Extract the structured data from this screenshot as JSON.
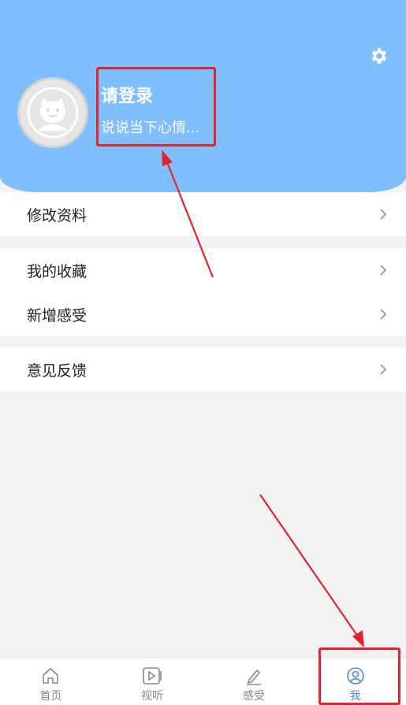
{
  "profile": {
    "login_text": "请登录",
    "mood_text": "说说当下心情...",
    "avatar_icon": "avatar-placeholder-icon",
    "settings_icon": "gear-icon"
  },
  "menu": {
    "edit_profile": "修改资料",
    "my_favorites": "我的收藏",
    "add_feeling": "新增感受",
    "feedback": "意见反馈"
  },
  "tabbar": {
    "items": [
      {
        "label": "首页",
        "icon": "home-icon"
      },
      {
        "label": "视听",
        "icon": "video-icon"
      },
      {
        "label": "感受",
        "icon": "pen-icon"
      },
      {
        "label": "我",
        "icon": "user-icon"
      }
    ],
    "active_index": 3
  },
  "colors": {
    "header_bg": "#80bfff",
    "page_bg": "#f2f2f4",
    "active_tab": "#4a90d9",
    "annotation": "#e0262b"
  }
}
